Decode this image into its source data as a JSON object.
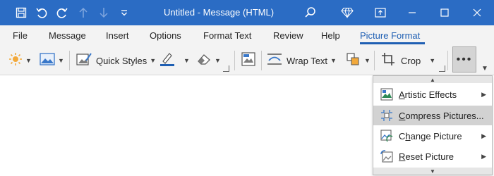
{
  "window": {
    "title": "Untitled  -  Message (HTML)",
    "colors": {
      "titlebar": "#2B6CC4",
      "accent": "#1F5FB3",
      "ribbon": "#F3F3F3"
    }
  },
  "quick_access": {
    "icons": [
      "save-icon",
      "undo-icon",
      "redo-icon",
      "up-arrow-icon",
      "down-arrow-icon",
      "customize-icon"
    ]
  },
  "titlebar_icons": [
    "search-icon",
    "diamond-icon",
    "restore-ribbon-icon",
    "minimize-icon",
    "maximize-icon",
    "close-icon"
  ],
  "tabs": [
    {
      "label": "File"
    },
    {
      "label": "Message"
    },
    {
      "label": "Insert"
    },
    {
      "label": "Options"
    },
    {
      "label": "Format Text"
    },
    {
      "label": "Review"
    },
    {
      "label": "Help"
    },
    {
      "label": "Picture Format",
      "active": true
    }
  ],
  "ribbon": {
    "quick_styles": "Quick Styles",
    "wrap_text": "Wrap Text",
    "crop": "Crop",
    "more": "•••"
  },
  "menu": {
    "items": [
      {
        "label": "Artistic Effects",
        "underline": "A",
        "rest": "rtistic Effects",
        "submenu": true
      },
      {
        "label": "Compress Pictures...",
        "underline": "C",
        "rest": "ompress Pictures...",
        "submenu": false,
        "hovered": true
      },
      {
        "label": "Change Picture",
        "underline": "",
        "pre": "C",
        "ul_mid": "h",
        "post": "ange Picture",
        "submenu": true
      },
      {
        "label": "Reset Picture",
        "underline": "R",
        "rest": "eset Picture",
        "submenu": true
      }
    ]
  }
}
